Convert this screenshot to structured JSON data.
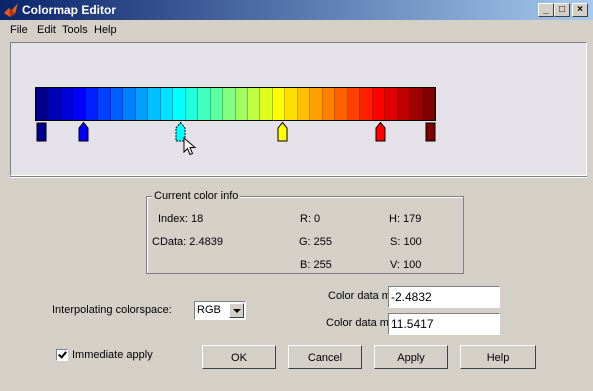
{
  "window": {
    "title": "Colormap Editor",
    "min_label": "_",
    "max_label": "□",
    "close_label": "×"
  },
  "menu": {
    "file": "File",
    "edit": "Edit",
    "tools": "Tools",
    "help": "Help"
  },
  "colormap": {
    "colors": [
      "#000090",
      "#0000b4",
      "#0000d8",
      "#0000ff",
      "#0020ff",
      "#0040ff",
      "#0060ff",
      "#0080ff",
      "#00a0ff",
      "#00c0ff",
      "#00e0ff",
      "#00ffff",
      "#20ffdf",
      "#40ffbf",
      "#60ff9f",
      "#80ff80",
      "#9fff60",
      "#bfff40",
      "#dfff20",
      "#ffff00",
      "#ffdf00",
      "#ffbf00",
      "#ff9f00",
      "#ff8000",
      "#ff6000",
      "#ff4000",
      "#ff2000",
      "#ff0000",
      "#df0000",
      "#bf0000",
      "#9f0000",
      "#800000"
    ],
    "markers": [
      {
        "color": "#000090",
        "shape": "square"
      },
      {
        "color": "#0000ff",
        "shape": "arrow"
      },
      {
        "color": "#00ffff",
        "shape": "arrow-selected"
      },
      {
        "color": "#ffff00",
        "shape": "arrow"
      },
      {
        "color": "#ff0000",
        "shape": "arrow"
      },
      {
        "color": "#800000",
        "shape": "square"
      }
    ]
  },
  "info": {
    "group_title": "Current color info",
    "index": "Index: 18",
    "cdata": "CData: 2.4839",
    "r": "R: 0",
    "g": "G: 255",
    "b": "B: 255",
    "h": "H: 179",
    "s": "S: 100",
    "v": "V: 100"
  },
  "controls": {
    "colorspace_label": "Interpolating colorspace:",
    "colorspace_value": "RGB",
    "min_label": "Color data min:",
    "min_value": "-2.4832",
    "max_label": "Color data max:",
    "max_value": "11.5417",
    "immediate_label": "Immediate apply",
    "immediate_checked": true,
    "ok": "OK",
    "cancel": "Cancel",
    "apply": "Apply",
    "help": "Help"
  }
}
